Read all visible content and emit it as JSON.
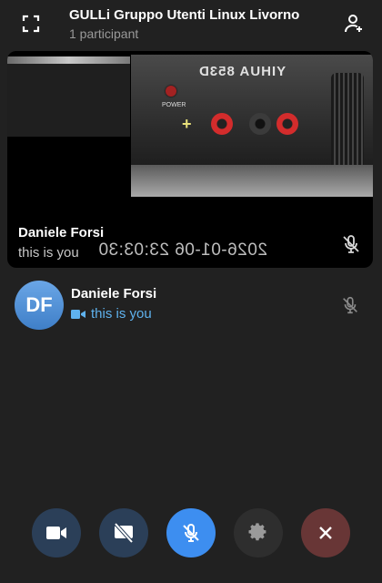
{
  "header": {
    "title": "GULLi Gruppo Utenti Linux Livorno",
    "subtitle": "1 participant",
    "fullscreen_icon": "fullscreen-icon",
    "add_participant_icon": "add-participant-icon"
  },
  "video_tile": {
    "name": "Daniele Forsi",
    "self_label": "this is you",
    "timestamp": "2026-01-06 23:03:30",
    "device_label": "YIHUA 853D",
    "power_label": "POWER",
    "mic_icon": "mic-off-icon"
  },
  "participant": {
    "initials": "DF",
    "name": "Daniele Forsi",
    "status": "this is you",
    "status_icon": "video-camera-icon",
    "mic_icon": "mic-off-icon"
  },
  "controls": {
    "video": "video-camera-icon",
    "screen_share": "screen-share-off-icon",
    "mic": "mic-off-icon",
    "settings": "gear-icon",
    "end_call": "close-icon"
  },
  "colors": {
    "background": "#212121",
    "accent": "#3d8ef0",
    "status_text": "#5fb2ee",
    "end_call": "#683636"
  }
}
